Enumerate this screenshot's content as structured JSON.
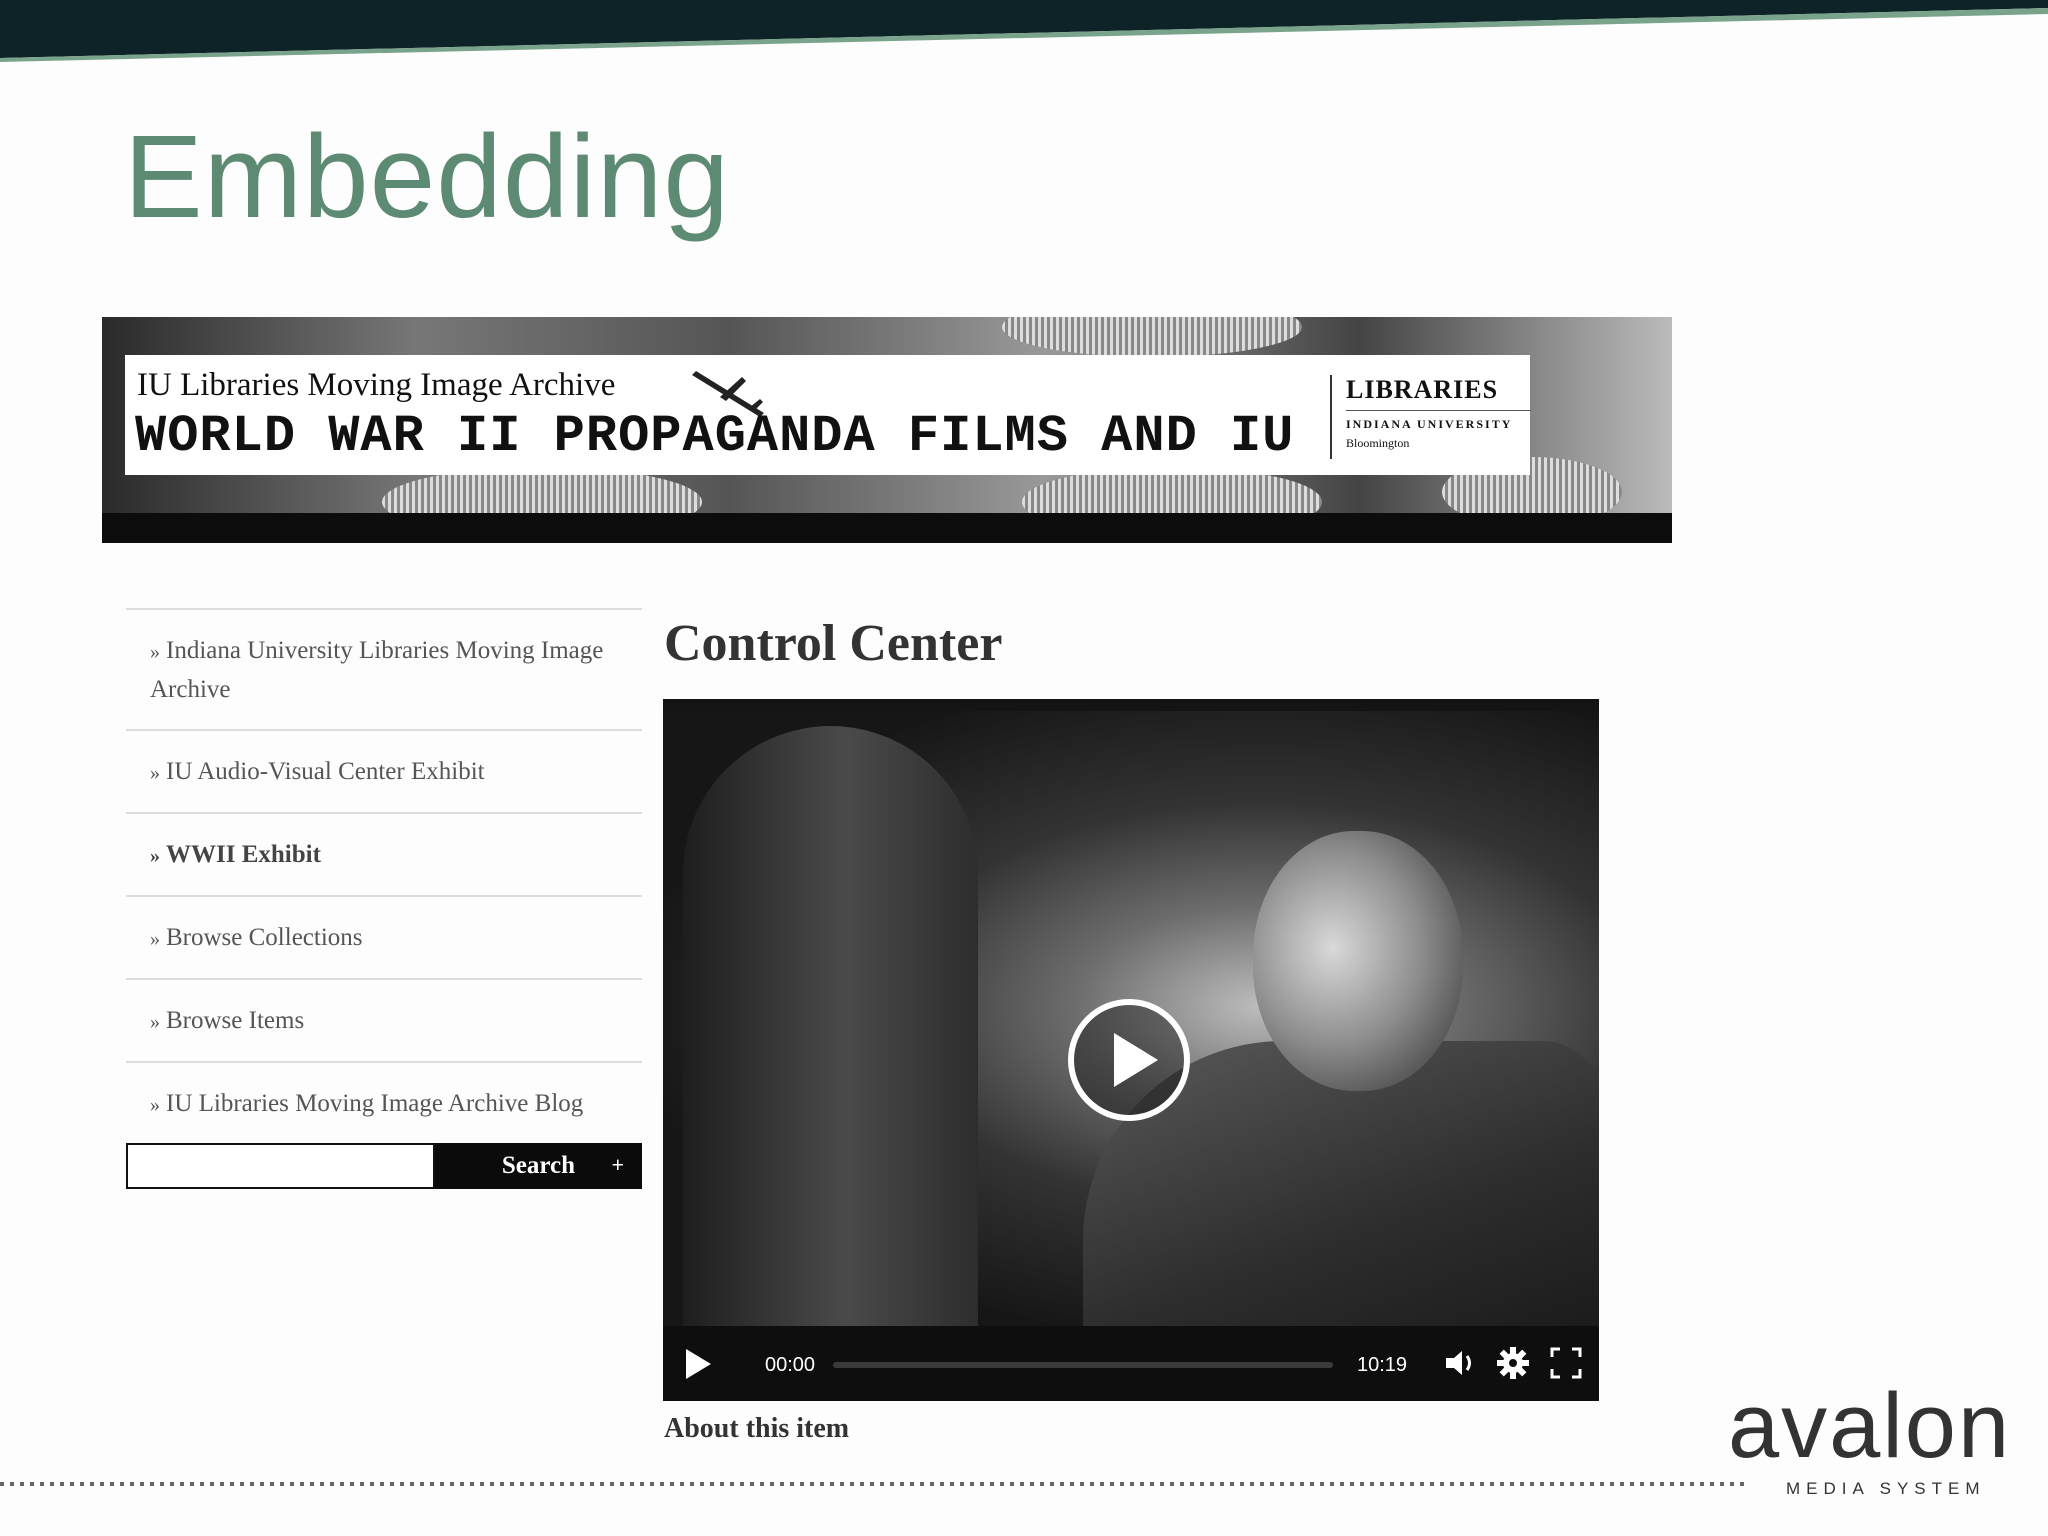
{
  "slide": {
    "title": "Embedding"
  },
  "banner": {
    "subtitle": "IU Libraries Moving Image Archive",
    "title": "WORLD WAR II PROPAGANDA FILMS AND IU",
    "logo_title": "LIBRARIES",
    "logo_university": "INDIANA UNIVERSITY",
    "logo_city": "Bloomington"
  },
  "sidebar": {
    "items": [
      {
        "label": "Indiana University Libraries Moving Image Archive"
      },
      {
        "label": "IU Audio-Visual Center Exhibit"
      },
      {
        "label": "WWII Exhibit"
      },
      {
        "label": "Browse Collections"
      },
      {
        "label": "Browse Items"
      },
      {
        "label": "IU Libraries Moving Image Archive Blog"
      }
    ],
    "search": {
      "placeholder": "",
      "button_label": "Search",
      "advanced_label": "+"
    }
  },
  "main": {
    "title": "Control Center",
    "player": {
      "current_time": "00:00",
      "duration": "10:19",
      "progress": 0
    },
    "about_heading": "About this item"
  },
  "footer": {
    "logo_word": "avalon",
    "logo_sub": "MEDIA SYSTEM"
  },
  "colors": {
    "title_green": "#5d8a72",
    "top_band": "#0e2328",
    "top_band_accent": "#7aa38b"
  }
}
